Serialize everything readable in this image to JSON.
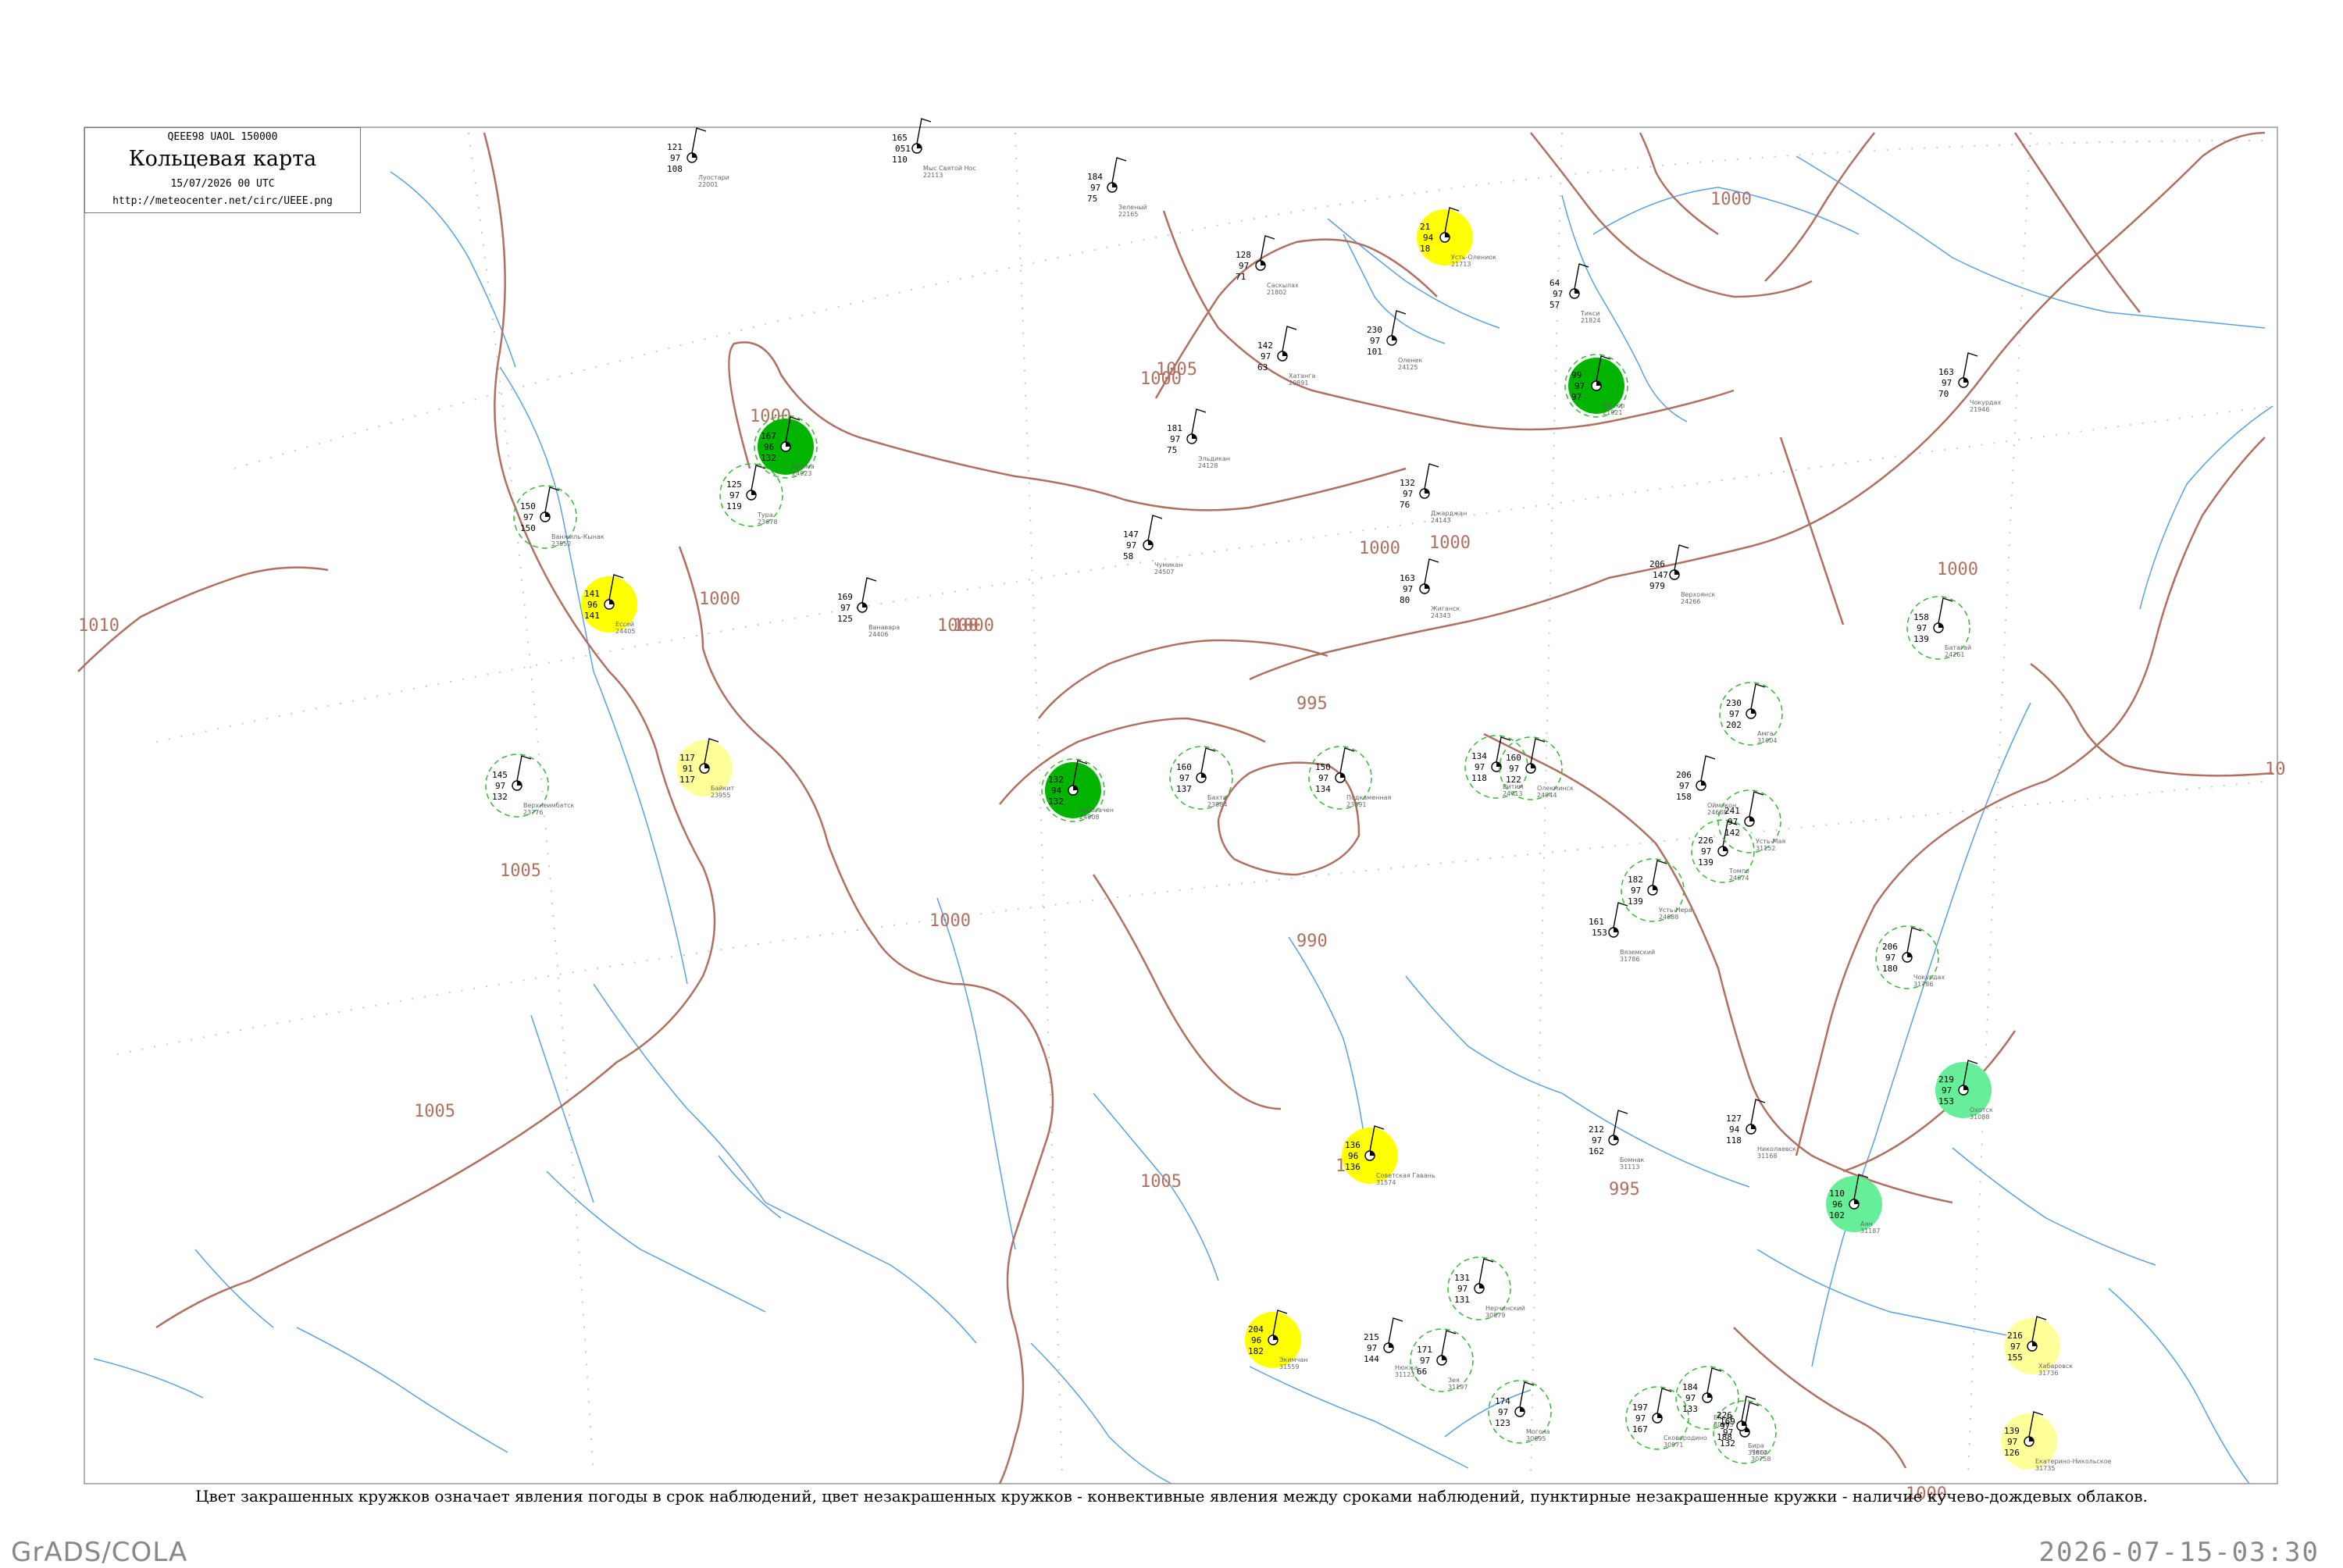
{
  "header": {
    "codes": "QEEE98  UAOL  150000",
    "title": "Кольцевая карта",
    "datetime": "15/07/2026 00 UTC",
    "url": "http://meteocenter.net/circ/UEEE.png"
  },
  "caption": "Цвет закрашенных кружков означает явления погоды в срок наблюдений, цвет незакрашенных кружков - конвективные явления между сроками наблюдений, пунктирные незакрашенные кружки - наличие кучево-дождевых облаков.",
  "footer": {
    "left": "GrADS/COLA",
    "right": "2026-07-15-03:30"
  },
  "colors": {
    "frame": "#999999",
    "isobar": "#b07060",
    "river": "#5aa0e6",
    "grid_dot": "#c8c8c8",
    "fill_yellow": "#ffff00",
    "fill_light_yellow": "#ffff99",
    "fill_green": "#00b400",
    "fill_light_green": "#66ee99",
    "fill_olive": "#b4b48c",
    "ring_green": "#33bb33",
    "ring_red": "#dd3333"
  },
  "isobar_labels": [
    "1000",
    "1005",
    "1000",
    "1000",
    "1000",
    "1000",
    "1000",
    "1000",
    "1000",
    "995",
    "990",
    "995",
    "1005",
    "1005",
    "1005",
    "1010",
    "1000",
    "1000",
    "1000",
    "1000",
    "10"
  ],
  "stations": [
    {
      "id": "s1",
      "p": "121",
      "t": "97",
      "dp": "108",
      "name": "Луостари",
      "idx": "22001"
    },
    {
      "id": "s2",
      "p": "165",
      "t": "051",
      "dp": "110",
      "name": "Мыс Святой Нос",
      "idx": "22113"
    },
    {
      "id": "s3",
      "p": "184",
      "t": "97",
      "dp": "75",
      "name": "Зеленый",
      "idx": "22165"
    },
    {
      "id": "s4",
      "p": "21",
      "t": "94",
      "dp": "18",
      "name": "Усть-Олениок",
      "idx": "21713"
    },
    {
      "id": "s5",
      "p": "64",
      "t": "97",
      "dp": "57",
      "name": "Тикси",
      "idx": "21824"
    },
    {
      "id": "s6",
      "p": "128",
      "t": "97",
      "dp": "71",
      "name": "Сaскылах",
      "idx": "21802"
    },
    {
      "id": "s7",
      "p": "230",
      "t": "97",
      "dp": "101",
      "name": "Оленек",
      "idx": "24125"
    },
    {
      "id": "s8",
      "p": "142",
      "t": "97",
      "dp": "63",
      "name": "Хатанга",
      "idx": "20891"
    },
    {
      "id": "s9",
      "p": "99",
      "t": "97",
      "dp": "97",
      "name": "Кюсюр",
      "idx": "21921"
    },
    {
      "id": "s10",
      "p": "163",
      "t": "97",
      "dp": "70",
      "name": "Чокурдах",
      "idx": "21946"
    },
    {
      "id": "s11",
      "p": "181",
      "t": "97",
      "dp": "75",
      "name": "Эльдикан",
      "idx": "24128"
    },
    {
      "id": "s12",
      "p": "132",
      "t": "97",
      "dp": "76",
      "name": "Джарджан",
      "idx": "24143"
    },
    {
      "id": "s13",
      "p": "206",
      "t": "147",
      "dp": "979",
      "name": "Верхоянск",
      "idx": "24266"
    },
    {
      "id": "s14",
      "p": "158",
      "t": "97",
      "dp": "139",
      "name": "Батагай",
      "idx": "24261"
    },
    {
      "id": "s15",
      "p": "147",
      "t": "97",
      "dp": "58",
      "name": "Чумикан",
      "idx": "24507"
    },
    {
      "id": "s16",
      "p": "163",
      "t": "97",
      "dp": "80",
      "name": "Жиганск",
      "idx": "24343"
    },
    {
      "id": "s17",
      "p": "169",
      "t": "97",
      "dp": "125",
      "name": "Ванавара",
      "idx": "24406"
    },
    {
      "id": "s18",
      "p": "125",
      "t": "97",
      "dp": "119",
      "name": "Тура",
      "idx": "23678"
    },
    {
      "id": "s19",
      "p": "141",
      "t": "96",
      "dp": "141",
      "name": "Ессей",
      "idx": "24405"
    },
    {
      "id": "s20",
      "p": "117",
      "t": "91",
      "dp": "117",
      "name": "Байкит",
      "idx": "23955"
    },
    {
      "id": "s21",
      "p": "132",
      "t": "94",
      "dp": "132",
      "name": "Ербогачен",
      "idx": "24908"
    },
    {
      "id": "s22",
      "p": "167",
      "t": "96",
      "dp": "132",
      "name": "Кежма",
      "idx": "24923"
    },
    {
      "id": "s23",
      "p": "150",
      "t": "97",
      "dp": "150",
      "name": "Ванжиль-Кынак",
      "idx": "23552"
    },
    {
      "id": "s24",
      "p": "145",
      "t": "97",
      "dp": "132",
      "name": "Верхнеимбатск",
      "idx": "23776"
    },
    {
      "id": "s25",
      "p": "160",
      "t": "97",
      "dp": "137",
      "name": "Бахта",
      "idx": "23884"
    },
    {
      "id": "s26",
      "p": "150",
      "t": "97",
      "dp": "134",
      "name": "Подкаменная",
      "idx": "23891"
    },
    {
      "id": "s27",
      "p": "134",
      "t": "97",
      "dp": "118",
      "name": "Витим",
      "idx": "24713"
    },
    {
      "id": "s28",
      "p": "160",
      "t": "97",
      "dp": "122",
      "name": "Олекминск",
      "idx": "24944"
    },
    {
      "id": "s29",
      "p": "230",
      "t": "97",
      "dp": "202",
      "name": "Амга",
      "idx": "31004"
    },
    {
      "id": "s30",
      "p": "206",
      "t": "97",
      "dp": "158",
      "name": "Оймякон",
      "idx": "24688"
    },
    {
      "id": "s31",
      "p": "226",
      "t": "97",
      "dp": "139",
      "name": "Томпо",
      "idx": "24674"
    },
    {
      "id": "s32",
      "p": "241",
      "t": "97",
      "dp": "142",
      "name": "Усть-Мая",
      "idx": "31152"
    },
    {
      "id": "s33",
      "p": "182",
      "t": "97",
      "dp": "139",
      "name": "Усть-Нера",
      "idx": "24688"
    },
    {
      "id": "s34",
      "p": "219",
      "t": "97",
      "dp": "153",
      "name": "Охотск",
      "idx": "31088"
    },
    {
      "id": "s35",
      "p": "110",
      "t": "96",
      "dp": "102",
      "name": "Аян",
      "idx": "31187"
    },
    {
      "id": "s36",
      "p": "127",
      "t": "94",
      "dp": "118",
      "name": "Николаевск",
      "idx": "31168"
    },
    {
      "id": "s37",
      "p": "212",
      "t": "97",
      "dp": "162",
      "name": "Бомнак",
      "idx": "31113"
    },
    {
      "id": "s38",
      "p": "136",
      "t": "96",
      "dp": "136",
      "name": "Советская Гавань",
      "idx": "31574"
    },
    {
      "id": "s39",
      "p": "204",
      "t": "96",
      "dp": "182",
      "name": "Экимчан",
      "idx": "31559"
    },
    {
      "id": "s40",
      "p": "171",
      "t": "97",
      "dp": "66",
      "name": "Зея",
      "idx": "31197"
    },
    {
      "id": "s41",
      "p": "215",
      "t": "97",
      "dp": "144",
      "name": "Нюкжа",
      "idx": "31123"
    },
    {
      "id": "s42",
      "p": "131",
      "t": "97",
      "dp": "131",
      "name": "Нерчинский",
      "idx": "30879"
    },
    {
      "id": "s43",
      "p": "174",
      "t": "97",
      "dp": "123",
      "name": "Могоча",
      "idx": "30695"
    },
    {
      "id": "s44",
      "p": "197",
      "t": "97",
      "dp": "167",
      "name": "Сковородино",
      "idx": "30971"
    },
    {
      "id": "s45",
      "p": "184",
      "t": "97",
      "dp": "133",
      "name": "Борзя",
      "idx": "30965"
    },
    {
      "id": "s46",
      "p": "169",
      "t": "97",
      "dp": "132",
      "name": "Чита",
      "idx": "30758"
    },
    {
      "id": "s47",
      "p": "226",
      "t": "97",
      "dp": "188",
      "name": "Бира",
      "idx": "31802"
    },
    {
      "id": "s48",
      "p": "216",
      "t": "97",
      "dp": "155",
      "name": "Хабаровск",
      "idx": "31736"
    },
    {
      "id": "s49",
      "p": "139",
      "t": "97",
      "dp": "126",
      "name": "Екатерино-Никольское",
      "idx": "31735"
    },
    {
      "id": "s50",
      "p": "161",
      "t": "153",
      "dp": "",
      "name": "Вяземский",
      "idx": "31786"
    },
    {
      "id": "s51",
      "p": "206",
      "t": "97",
      "dp": "180",
      "name": "Чокурдах",
      "idx": "31786"
    }
  ]
}
